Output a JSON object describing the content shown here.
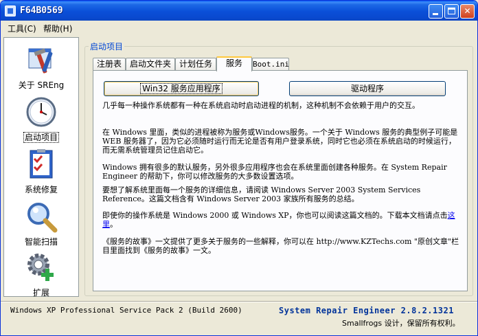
{
  "window": {
    "title": "F64B0569",
    "minimize": "",
    "maximize": "",
    "close": "✕"
  },
  "menu": {
    "tools": "工具(C)",
    "help": "帮助(H)"
  },
  "nav": {
    "items": [
      {
        "label": "关于 SREng",
        "icon": "tools-icon"
      },
      {
        "label": "启动项目",
        "icon": "clock-icon"
      },
      {
        "label": "系统修复",
        "icon": "checklist-icon"
      },
      {
        "label": "智能扫描",
        "icon": "magnifier-icon"
      },
      {
        "label": "扩展",
        "icon": "gear-plus-icon"
      }
    ],
    "active": 1
  },
  "group": {
    "title": "启动项目"
  },
  "tabs": [
    {
      "label": "注册表"
    },
    {
      "label": "启动文件夹"
    },
    {
      "label": "计划任务"
    },
    {
      "label": "服务"
    },
    {
      "label": "Boot.ini"
    }
  ],
  "active_tab": 3,
  "buttons": {
    "win32": "Win32 服务应用程序",
    "driver": "驱动程序"
  },
  "content": {
    "p1": "几乎每一种操作系统都有一种在系统启动时启动进程的机制，这种机制不会依赖于用户的交互。",
    "p2": "在 Windows 里面，类似的进程被称为服务或Windows服务。一个关于 Windows 服务的典型例子可能是 WEB 服务器了，因为它必须随时运行而无论是否有用户登录系统，同时它也必须在系统启动的时候运行，而无需系统管理员记住启动它。",
    "p3": "Windows 拥有很多的默认服务，另外很多应用程序也会在系统里面创建各种服务。在 System Repair Engineer 的帮助下，你可以修改服务的大多数设置选项。",
    "p4": "要想了解系统里面每一个服务的详细信息，请阅读 Windows Server 2003 System Services Reference。这篇文档含有 Windows Server 2003 家族所有服务的总结。",
    "p5_text": "即使你的操作系统是 Windows 2000 或 Windows XP，你也可以阅读这篇文档的。下载本文档请点击",
    "p5_link": "这里",
    "p5_end": "。",
    "p6": "《服务的故事》一文提供了更多关于服务的一些解释，你可以在 http://www.KZTechs.com \"原创文章\"栏目里面找到《服务的故事》一文。"
  },
  "status": {
    "os": "Windows XP Professional Service Pack 2 (Build 2600)",
    "version": "System Repair Engineer 2.8.2.1321",
    "copyright": "Smallfrogs 设计，保留所有权利。"
  }
}
